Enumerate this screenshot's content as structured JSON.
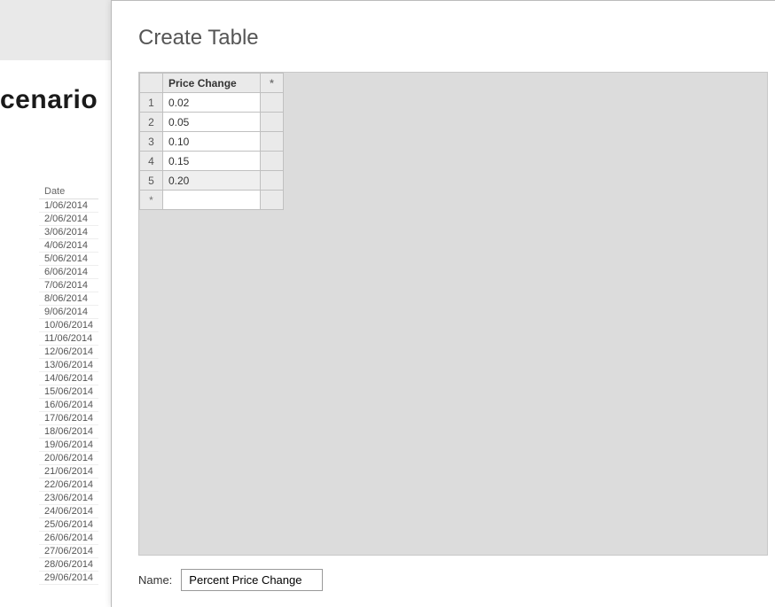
{
  "background": {
    "heading_fragment": "cenario",
    "date_column": {
      "header": "Date",
      "rows": [
        "1/06/2014",
        "2/06/2014",
        "3/06/2014",
        "4/06/2014",
        "5/06/2014",
        "6/06/2014",
        "7/06/2014",
        "8/06/2014",
        "9/06/2014",
        "10/06/2014",
        "11/06/2014",
        "12/06/2014",
        "13/06/2014",
        "14/06/2014",
        "15/06/2014",
        "16/06/2014",
        "17/06/2014",
        "18/06/2014",
        "19/06/2014",
        "20/06/2014",
        "21/06/2014",
        "22/06/2014",
        "23/06/2014",
        "24/06/2014",
        "25/06/2014",
        "26/06/2014",
        "27/06/2014",
        "28/06/2014",
        "29/06/2014"
      ]
    }
  },
  "dialog": {
    "title": "Create Table",
    "table": {
      "column_header": "Price Change",
      "add_column_marker": "*",
      "add_row_marker": "*",
      "rows": [
        {
          "n": "1",
          "val": "0.02"
        },
        {
          "n": "2",
          "val": "0.05"
        },
        {
          "n": "3",
          "val": "0.10"
        },
        {
          "n": "4",
          "val": "0.15"
        },
        {
          "n": "5",
          "val": "0.20"
        }
      ],
      "selected_index": 4
    },
    "name_label": "Name:",
    "name_value": "Percent Price Change"
  }
}
